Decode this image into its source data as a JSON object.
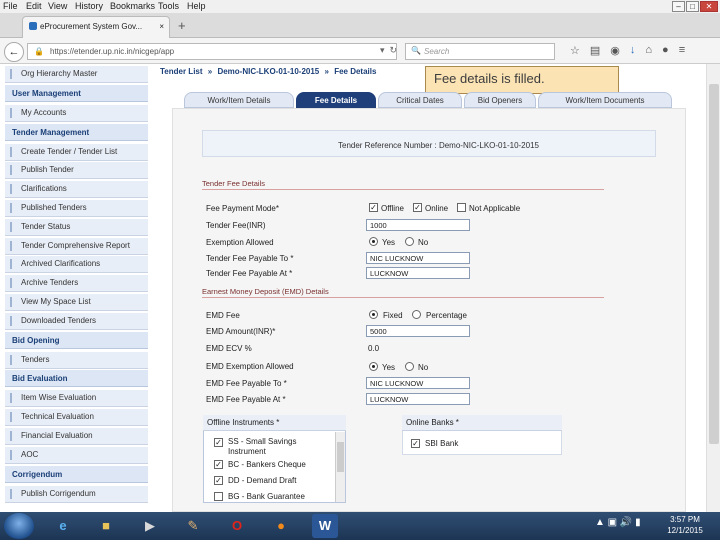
{
  "browser": {
    "menu": [
      "File",
      "Edit",
      "View",
      "History",
      "Bookmarks",
      "Tools",
      "Help"
    ],
    "window_buttons": [
      "–",
      "□",
      "✕"
    ],
    "tab_title": "eProcurement System Gov...",
    "tab_close": "×",
    "new_tab": "+",
    "url": "https://etender.up.nic.in/nicgep/app",
    "search_placeholder": "Search",
    "back_glyph": "←"
  },
  "sidebar": {
    "items": [
      {
        "type": "item",
        "label": "Org Hierarchy Master"
      },
      {
        "type": "head",
        "label": "User Management"
      },
      {
        "type": "item",
        "label": "My Accounts"
      },
      {
        "type": "head",
        "label": "Tender Management"
      },
      {
        "type": "item",
        "label": "Create Tender / Tender List"
      },
      {
        "type": "item",
        "label": "Publish Tender"
      },
      {
        "type": "item",
        "label": "Clarifications"
      },
      {
        "type": "item",
        "label": "Published Tenders"
      },
      {
        "type": "item",
        "label": "Tender Status"
      },
      {
        "type": "item",
        "label": "Tender Comprehensive Report"
      },
      {
        "type": "item",
        "label": "Archived Clarifications"
      },
      {
        "type": "item",
        "label": "Archive Tenders"
      },
      {
        "type": "item",
        "label": "View My Space List"
      },
      {
        "type": "item",
        "label": "Downloaded Tenders"
      },
      {
        "type": "head",
        "label": "Bid Opening"
      },
      {
        "type": "item",
        "label": "Tenders"
      },
      {
        "type": "head",
        "label": "Bid Evaluation"
      },
      {
        "type": "item",
        "label": "Item Wise Evaluation"
      },
      {
        "type": "item",
        "label": "Technical Evaluation"
      },
      {
        "type": "item",
        "label": "Financial Evaluation"
      },
      {
        "type": "item",
        "label": "AOC"
      },
      {
        "type": "head",
        "label": "Corrigendum"
      },
      {
        "type": "item",
        "label": "Publish Corrigendum"
      }
    ]
  },
  "breadcrumb": [
    "Tender List",
    "»",
    "Demo-NIC-LKO-01-10-2015",
    "»",
    "Fee Details"
  ],
  "tooltip": "Fee details is filled.",
  "tabs": [
    "Work/Item Details",
    "Fee Details",
    "Critical Dates",
    "Bid Openers",
    "Work/Item Documents"
  ],
  "active_tab": "Fee Details",
  "reference": "Tender Reference Number : Demo-NIC-LKO-01-10-2015",
  "tender_fee": {
    "section": "Tender Fee Details",
    "payment_mode_label": "Fee Payment Mode*",
    "payment_modes": [
      {
        "label": "Offline",
        "checked": true
      },
      {
        "label": "Online",
        "checked": true
      },
      {
        "label": "Not Applicable",
        "checked": false
      }
    ],
    "fee_label": "Tender Fee(INR)",
    "fee_value": "1000",
    "exemption_label": "Exemption Allowed",
    "exemption_yes": "Yes",
    "exemption_no": "No",
    "payable_to_label": "Tender Fee Payable To *",
    "payable_to_value": "NIC LUCKNOW",
    "payable_at_label": "Tender Fee Payable At *",
    "payable_at_value": "LUCKNOW"
  },
  "emd": {
    "section": "Earnest Money Deposit (EMD) Details",
    "fee_label": "EMD Fee",
    "fixed": "Fixed",
    "percentage": "Percentage",
    "amount_label": "EMD Amount(INR)*",
    "amount_value": "5000",
    "ecv_label": "EMD ECV %",
    "ecv_value": "0.0",
    "exemption_label": "EMD Exemption Allowed",
    "yes": "Yes",
    "no": "No",
    "payable_to_label": "EMD Fee Payable To *",
    "payable_to_value": "NIC LUCKNOW",
    "payable_at_label": "EMD Fee Payable At *",
    "payable_at_value": "LUCKNOW"
  },
  "offline_instruments": {
    "title": "Offline Instruments *",
    "items": [
      {
        "label": "SS - Small Savings Instrument",
        "checked": true
      },
      {
        "label": "BC - Bankers Cheque",
        "checked": true
      },
      {
        "label": "DD - Demand Draft",
        "checked": true
      },
      {
        "label": "BG - Bank Guarantee",
        "checked": false
      }
    ]
  },
  "online_banks": {
    "title": "Online Banks *",
    "items": [
      {
        "label": "SBI Bank",
        "checked": true
      }
    ]
  },
  "taskbar": {
    "time": "3:57 PM",
    "date": "12/1/2015"
  },
  "colors": {
    "nav_dark": "#1e3f7a",
    "tooltip_bg": "#fbe3b4",
    "section_text": "#7a3030"
  }
}
